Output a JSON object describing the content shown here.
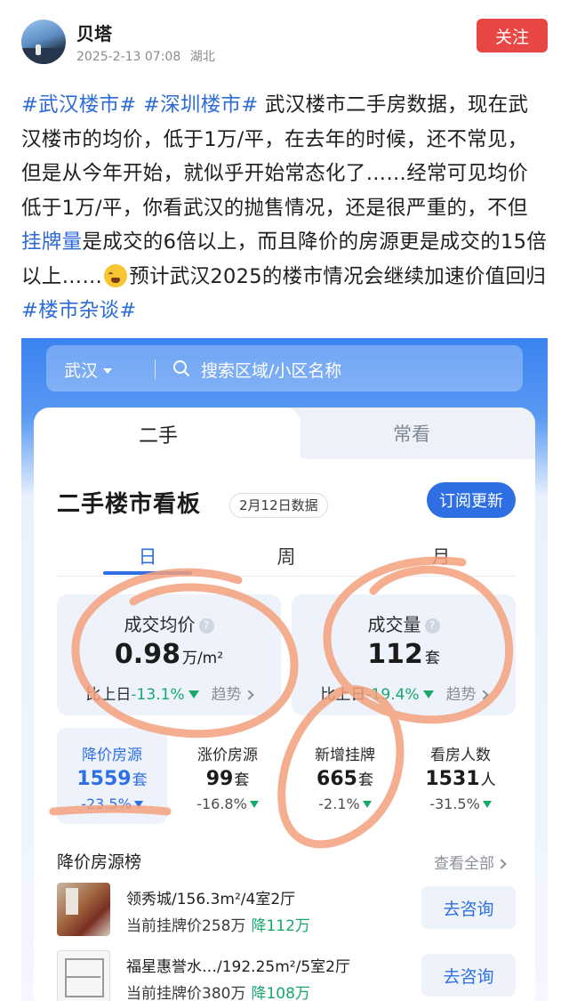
{
  "post": {
    "author": "贝塔",
    "date": "2025-2-13 07:08",
    "location": "湖北",
    "follow_label": "关注",
    "text": {
      "topic1": "#武汉楼市#",
      "topic2": "#深圳楼市#",
      "p1": " 武汉楼市二手房数据，现在武汉楼市的均价，低于1万/平，在去年的时候，还不常见，但是从今年开始，就似乎开始常态化了……经常可见均价低于1万/平，你看武汉的抛售情况，还是很严重的，不但",
      "keyword": "挂牌量",
      "p2": "是成交的6倍以上，而且降价的房源更是成交的15倍以上……",
      "p3": "预计武汉2025的楼市情况会继续加速价值回归",
      "topic3": "#楼市杂谈#"
    }
  },
  "app": {
    "search": {
      "city": "武汉",
      "placeholder": "搜索区域/小区名称"
    },
    "tabs": [
      "二手",
      "常看"
    ],
    "board": {
      "title": "二手楼市看板",
      "date_badge": "2月12日数据",
      "subscribe_label": "订阅更新"
    },
    "period_tabs": [
      "日",
      "周",
      "月"
    ],
    "metrics": [
      {
        "title": "成交均价",
        "value": "0.98",
        "unit": "万/m²",
        "compare_label": "比上日",
        "change": "-13.1%",
        "trend_label": "趋势"
      },
      {
        "title": "成交量",
        "value": "112",
        "unit": "套",
        "compare_label": "比上日",
        "change": "-19.4%",
        "trend_label": "趋势"
      }
    ],
    "stats": [
      {
        "title": "降价房源",
        "value": "1559",
        "unit": "套",
        "change": "-23.5%"
      },
      {
        "title": "涨价房源",
        "value": "99",
        "unit": "套",
        "change": "-16.8%"
      },
      {
        "title": "新增挂牌",
        "value": "665",
        "unit": "套",
        "change": "-2.1%"
      },
      {
        "title": "看房人数",
        "value": "1531",
        "unit": "人",
        "change": "-31.5%"
      }
    ],
    "list": {
      "header": "降价房源榜",
      "view_all": "查看全部",
      "items": [
        {
          "title": "领秀城/156.3m²/4室2厅",
          "price_label": "当前挂牌价",
          "price": "258万",
          "drop": "降112万",
          "action": "去咨询"
        },
        {
          "title": "福星惠誉水…/192.25m²/5室2厅",
          "price_label": "当前挂牌价",
          "price": "380万",
          "drop": "降108万",
          "action": "去咨询"
        }
      ]
    }
  },
  "colors": {
    "accent": "#2f6fe4",
    "follow": "#e94746",
    "down": "#17a86b",
    "topic": "#2d6bd8",
    "annotation": "#f3a07c"
  }
}
